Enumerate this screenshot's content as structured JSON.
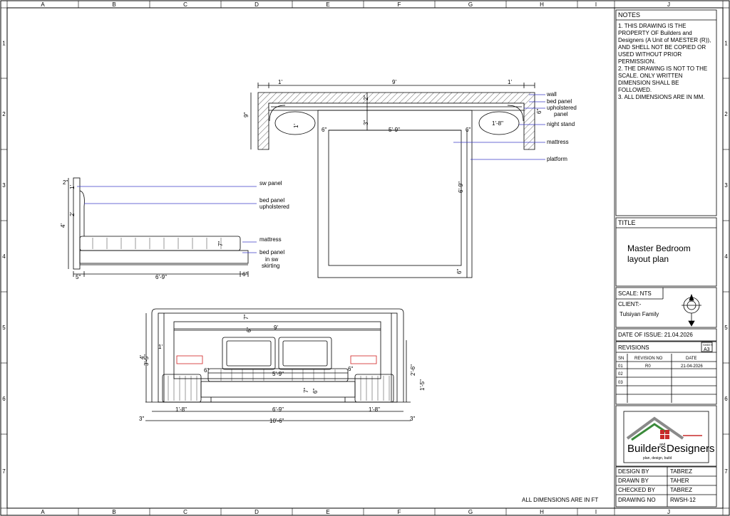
{
  "grid": {
    "cols": [
      "A",
      "B",
      "C",
      "D",
      "E",
      "F",
      "G",
      "H",
      "I",
      "J"
    ],
    "rows": [
      "1",
      "2",
      "3",
      "4",
      "5",
      "6",
      "7"
    ]
  },
  "notes": {
    "heading": "NOTES",
    "items": [
      "1.  THIS DRAWING IS THE PROPERTY OF Builders and Designers (A Unit of MAESTER (R)),  AND SHELL NOT BE COPIED OR USED WITHOUT PRIOR PERMISSION.",
      "2.  THE DRAWING  IS NOT TO THE SCALE. ONLY WRITTEN DIMENSION SHALL BE FOLLOWED.",
      "3.  ALL DIMENSIONS ARE IN MM."
    ]
  },
  "title_block": {
    "title_heading": "TITLE",
    "title": "Master Bedroom layout plan",
    "scale": "SCALE: NTS",
    "client_label": "CLIENT:-",
    "client": "Tulsiyan Family",
    "date_of_issue": "DATE OF ISSUE:  21.04.2026",
    "revisions_heading": "REVISIONS",
    "sheet_size_label": "SHEET",
    "sheet_size": "A3",
    "rev_headers": [
      "SN",
      "REVISION NO",
      "DATE"
    ],
    "rev_rows": [
      [
        "01",
        "R0",
        "21-04-2026"
      ],
      [
        "02",
        "",
        ""
      ],
      [
        "03",
        "",
        ""
      ],
      [
        "",
        "",
        ""
      ]
    ],
    "logo_text_1": "Builders",
    "logo_text_2": "Designers",
    "logo_and": "and",
    "logo_tagline": "plan, design, build",
    "design_by_label": "DESIGN BY",
    "design_by": "TABREZ",
    "drawn_by_label": "DRAWN BY",
    "drawn_by": "TAHER",
    "checked_by_label": "CHECKED BY",
    "checked_by": "TABREZ",
    "drawing_no_label": "DRAWING NO",
    "drawing_no": "RWSH-12"
  },
  "footer_note": "ALL DIMENSIONS ARE IN  FT",
  "plan_view": {
    "dims": {
      "left_wall": "1'",
      "width": "9'",
      "right_wall": "1'",
      "depth": "9\"",
      "panel_gap": "2\"",
      "panel_depth": "3\"",
      "left_ns": "1'",
      "right_ns": "1'-8\"",
      "side_left": "6\"",
      "side_right": "6\"",
      "mattress_w": "5'-9\"",
      "length": "6'-9\"",
      "foot": "6\"",
      "wall_t": "6\""
    },
    "labels": [
      "wall",
      "bed panel",
      "upholstered",
      "panel",
      "night stand",
      "mattress",
      "platform"
    ]
  },
  "side_view": {
    "dims": {
      "top": "2\"",
      "top_v": "1'",
      "panel_h": "2'",
      "total_h": "4'",
      "mattress_h": "7\"",
      "left": "5\"",
      "length": "6'-9\"",
      "right": "6\""
    },
    "labels": [
      "sw panel",
      "bed panel",
      "upholstered",
      "mattress",
      "bed panel",
      "in sw",
      "skirting"
    ]
  },
  "elevation_view": {
    "dims": {
      "top1": "7\"",
      "top2": "6\"",
      "panel_w": "9'",
      "left_side": "1'",
      "total_h_label": "4'",
      "total_h": "3'-5\"",
      "right_h": "2'-6\"",
      "ns_h": "1'-5\"",
      "left_gap": "6\"",
      "right_gap": "6\"",
      "mattress_w": "5'-9\"",
      "matt_h": "7\"",
      "base_h": "6\"",
      "ns_left_w": "1'-8\"",
      "bed_w": "6'-9\"",
      "ns_right_w": "1'-8\"",
      "left_end": "3\"",
      "total_w": "10'-6\"",
      "right_end": "3\""
    }
  }
}
